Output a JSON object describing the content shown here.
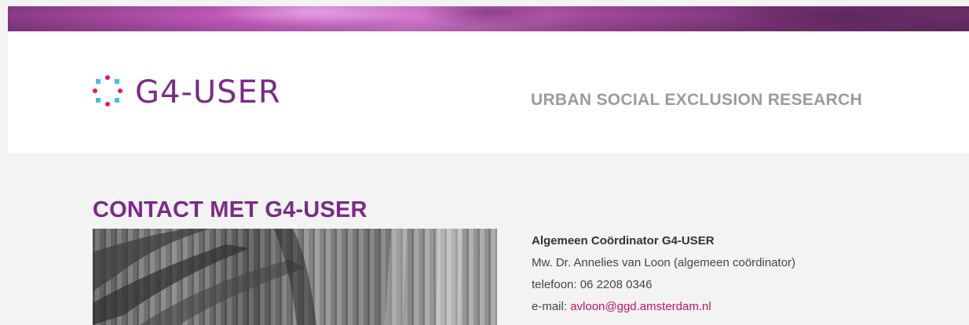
{
  "brand": {
    "logo_text": "G4-USER",
    "tagline": "URBAN SOCIAL EXCLUSION RESEARCH",
    "colors": {
      "purple": "#7b2a88",
      "dot_cyan": "#3fc0e8",
      "dot_magenta": "#e5195f",
      "tagline_gray": "#9b9b9b",
      "link_red": "#c2175b"
    }
  },
  "main": {
    "title": "CONTACT MET G4-USER",
    "contact": {
      "role": "Algemeen Coördinator G4-USER",
      "name": "Mw. Dr. Annelies van Loon (algemeen coördinator)",
      "phone": "telefoon: 06 2208 0346",
      "email_label": "e-mail:",
      "email": "avloon@ggd.amsterdam.nl"
    }
  },
  "icons": {
    "logo": "dots-ring-icon",
    "banner": "banner-photo",
    "photo": "library-bookshelves-photo"
  }
}
